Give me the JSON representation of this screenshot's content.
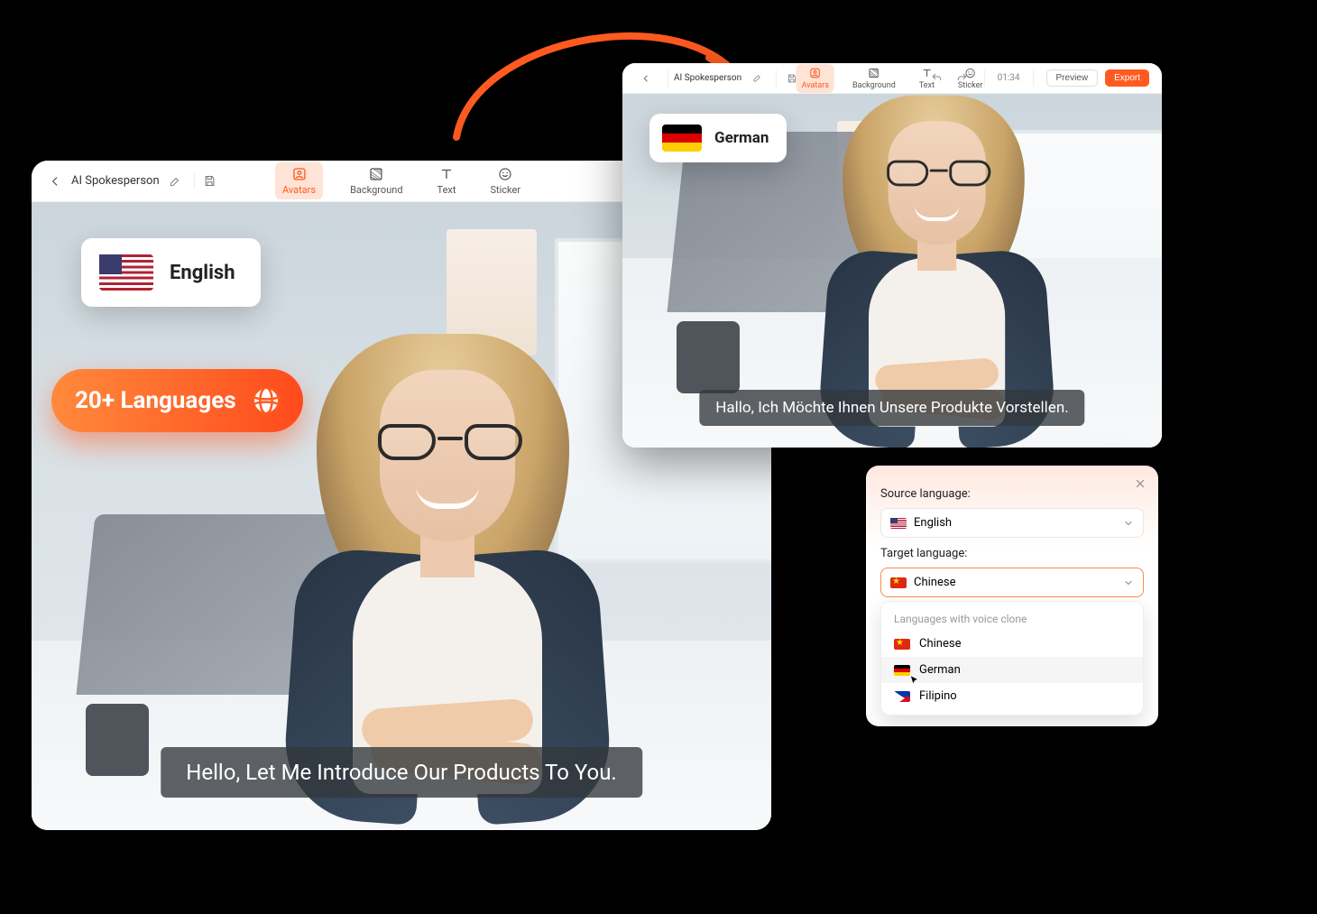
{
  "colors": {
    "accent": "#ff5a1f"
  },
  "arrow": {
    "color": "#ff5a1f"
  },
  "editor_left": {
    "title": "AI Spokesperson",
    "tabs": {
      "avatars": "Avatars",
      "background": "Background",
      "text": "Text",
      "sticker": "Sticker"
    },
    "active_tab": "avatars",
    "language_card": {
      "label": "English"
    },
    "badge": "20+ Languages",
    "subtitle": "Hello,  Let Me Introduce Our Products To You."
  },
  "editor_right": {
    "title": "AI Spokesperson",
    "tabs": {
      "avatars": "Avatars",
      "background": "Background",
      "text": "Text",
      "sticker": "Sticker"
    },
    "active_tab": "avatars",
    "time": "01:34",
    "preview_label": "Preview",
    "export_label": "Export",
    "language_card": {
      "label": "German"
    },
    "subtitle": "Hallo, Ich Möchte Ihnen Unsere Produkte Vorstellen."
  },
  "lang_panel": {
    "source_label": "Source language:",
    "source_value": "English",
    "target_label": "Target language:",
    "target_value": "Chinese",
    "group_label": "Languages with voice clone",
    "options": [
      {
        "label": "Chinese",
        "flag": "cn"
      },
      {
        "label": "German",
        "flag": "de"
      },
      {
        "label": "Filipino",
        "flag": "ph"
      }
    ],
    "hover_index": 1
  }
}
